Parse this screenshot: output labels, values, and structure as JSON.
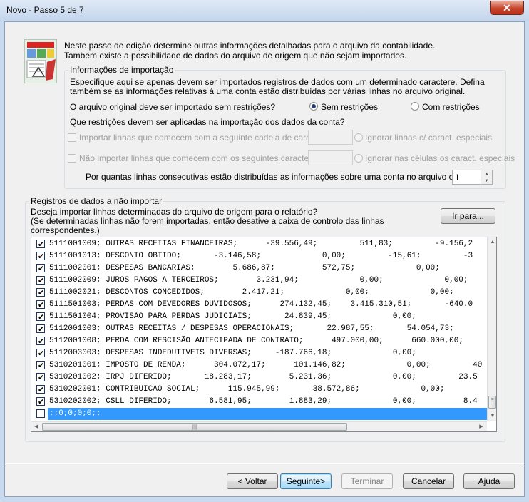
{
  "window": {
    "title": "Novo - Passo 5 de 7",
    "close_glyph": "✕"
  },
  "intro": {
    "line1": "Neste passo de edição determine outras informações detalhadas para o arquivo da contabilidade.",
    "line2": "Também existe a possibilidade de dados do arquivo de origem que não sejam importados."
  },
  "import_info": {
    "title": "Informações de importação",
    "desc1": "Especifique aqui se apenas devem ser importados registros de dados com um determinado caractere. Defina",
    "desc2": "também se as informações relativas à uma conta estão distribuídas por várias linhas no arquivo original.",
    "question1": "O arquivo original deve ser importado sem restrições?",
    "radio_without": "Sem restrições",
    "radio_with": "Com restrições",
    "question2": "Que restrições devem ser aplicadas na importação dos dados da conta?",
    "opt_import_lines": "Importar linhas que comecem com a seguinte cadeia de caracteres:",
    "opt_ignore_special": "Ignorar linhas c/ caract. especiais",
    "opt_not_import_lines": "Não importar linhas que comecem com os seguintes caracteres:",
    "opt_ignore_cells": "Ignorar nas células os caract. especiais",
    "lines_question": "Por quantas linhas consecutivas estão distribuídas as informações sobre uma conta no arquivo original?",
    "lines_value": "1"
  },
  "records": {
    "title": "Registros de dados a não importar",
    "desc1": "Deseja importar linhas determinadas do arquivo de origem para o relatório?",
    "desc2": "(Se determinadas linhas não forem importadas, então desative a caixa de controlo das linhas",
    "desc3": "correspondentes.)",
    "goto_label": "Ir para...",
    "rows": [
      {
        "checked": true,
        "text": "5111001009; OUTRAS RECEITAS FINANCEIRAS;      -39.556,49;         511,83;         -9.156,2"
      },
      {
        "checked": true,
        "text": "5111001013; DESCONTO OBTIDO;       -3.146,58;             0,00;         -15,61;         -3"
      },
      {
        "checked": true,
        "text": "5111002001; DESPESAS BANCARIAS;        5.686,87;          572,75;             0,00;"
      },
      {
        "checked": true,
        "text": "5111002009; JUROS PAGOS A TERCEIROS;        3.231,94;             0,00;             0,00;"
      },
      {
        "checked": true,
        "text": "5111002021; DESCONTOS CONCEDIDOS;        2.417,21;             0,00;             0,00;"
      },
      {
        "checked": true,
        "text": "5111501003; PERDAS COM DEVEDORES DUVIDOSOS;      274.132,45;    3.415.310,51;       -640.0"
      },
      {
        "checked": true,
        "text": "5111501004; PROVISÃO PARA PERDAS JUDICIAIS;       24.839,45;             0,00;"
      },
      {
        "checked": true,
        "text": "5112001003; OUTRAS RECEITAS / DESPESAS OPERACIONAIS;       22.987,55;       54.054,73;"
      },
      {
        "checked": true,
        "text": "5112001008; PERDA COM RESCISÃO ANTECIPADA DE CONTRATO;      497.000,00;      660.000,00;"
      },
      {
        "checked": true,
        "text": "5112003003; DESPESAS INDEDUTIVEIS DIVERSAS;     -187.766,18;             0,00;"
      },
      {
        "checked": true,
        "text": "5310201001; IMPOSTO DE RENDA;      304.072,17;      101.146,82;             0,00;         40"
      },
      {
        "checked": true,
        "text": "5310201002; IRPJ DIFERIDO;       18.283,17;        5.231,36;             0,00;         23.5"
      },
      {
        "checked": true,
        "text": "5310202001; CONTRIBUICAO SOCIAL;      115.945,99;       38.572,86;             0,00;"
      },
      {
        "checked": true,
        "text": "5310202002; CSLL DIFERIDO;        6.581,95;        1.883,29;             0,00;          8.4"
      },
      {
        "checked": false,
        "text": ";;0;0;0;0;;",
        "selected": true
      }
    ]
  },
  "buttons": {
    "back": "< Voltar",
    "next": "Seguinte>",
    "finish": "Terminar",
    "cancel": "Cancelar",
    "help": "Ajuda"
  }
}
